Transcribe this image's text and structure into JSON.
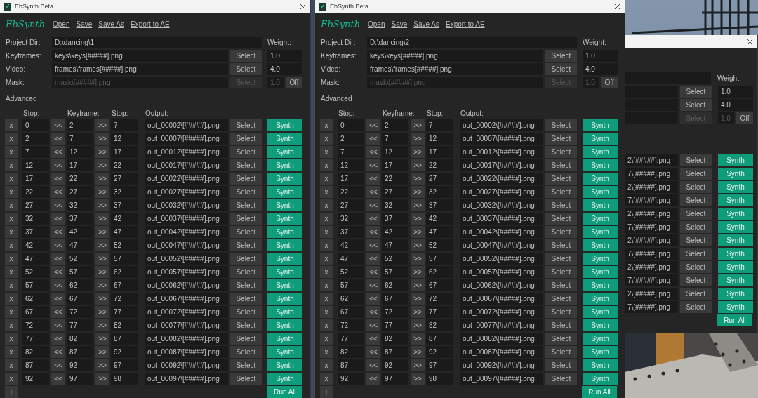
{
  "windows": [
    {
      "title": "EbSynth Beta",
      "logo": "EbSynth",
      "menu": [
        "Open",
        "Save",
        "Save As",
        "Export to AE"
      ],
      "project_dir": {
        "label": "Project Dir:",
        "value": "D:\\dancing\\1"
      },
      "weight_label": "Weight:",
      "inputs": [
        {
          "label": "Keyframes:",
          "value": "keys\\keys[#####].png",
          "select": "Select",
          "weight": "1.0",
          "disabled": false
        },
        {
          "label": "Video:",
          "value": "frames\\frames[#####].png",
          "select": "Select",
          "weight": "4.0",
          "disabled": false
        },
        {
          "label": "Mask:",
          "value": "mask\\[#####].png",
          "select": "Select",
          "weight": "1.0",
          "disabled": true,
          "toggle": "Off"
        }
      ],
      "advanced": "Advanced",
      "headers": [
        "Stop:",
        "Keyframe:",
        "Stop:",
        "Output:"
      ],
      "rows": [
        {
          "x": "x",
          "from": "0",
          "back": "<<",
          "key": "2",
          "fwd": ">>",
          "to": "7",
          "output": "out_00002\\[#####].png",
          "select": "Select",
          "synth": "Synth"
        },
        {
          "x": "x",
          "from": "2",
          "back": "<<",
          "key": "7",
          "fwd": ">>",
          "to": "12",
          "output": "out_00007\\[#####].png",
          "select": "Select",
          "synth": "Synth"
        },
        {
          "x": "x",
          "from": "7",
          "back": "<<",
          "key": "12",
          "fwd": ">>",
          "to": "17",
          "output": "out_00012\\[#####].png",
          "select": "Select",
          "synth": "Synth"
        },
        {
          "x": "x",
          "from": "12",
          "back": "<<",
          "key": "17",
          "fwd": ">>",
          "to": "22",
          "output": "out_00017\\[#####].png",
          "select": "Select",
          "synth": "Synth"
        },
        {
          "x": "x",
          "from": "17",
          "back": "<<",
          "key": "22",
          "fwd": ">>",
          "to": "27",
          "output": "out_00022\\[#####].png",
          "select": "Select",
          "synth": "Synth"
        },
        {
          "x": "x",
          "from": "22",
          "back": "<<",
          "key": "27",
          "fwd": ">>",
          "to": "32",
          "output": "out_00027\\[#####].png",
          "select": "Select",
          "synth": "Synth"
        },
        {
          "x": "x",
          "from": "27",
          "back": "<<",
          "key": "32",
          "fwd": ">>",
          "to": "37",
          "output": "out_00032\\[#####].png",
          "select": "Select",
          "synth": "Synth"
        },
        {
          "x": "x",
          "from": "32",
          "back": "<<",
          "key": "37",
          "fwd": ">>",
          "to": "42",
          "output": "out_00037\\[#####].png",
          "select": "Select",
          "synth": "Synth"
        },
        {
          "x": "x",
          "from": "37",
          "back": "<<",
          "key": "42",
          "fwd": ">>",
          "to": "47",
          "output": "out_00042\\[#####].png",
          "select": "Select",
          "synth": "Synth"
        },
        {
          "x": "x",
          "from": "42",
          "back": "<<",
          "key": "47",
          "fwd": ">>",
          "to": "52",
          "output": "out_00047\\[#####].png",
          "select": "Select",
          "synth": "Synth"
        },
        {
          "x": "x",
          "from": "47",
          "back": "<<",
          "key": "52",
          "fwd": ">>",
          "to": "57",
          "output": "out_00052\\[#####].png",
          "select": "Select",
          "synth": "Synth"
        },
        {
          "x": "x",
          "from": "52",
          "back": "<<",
          "key": "57",
          "fwd": ">>",
          "to": "62",
          "output": "out_00057\\[#####].png",
          "select": "Select",
          "synth": "Synth"
        },
        {
          "x": "x",
          "from": "57",
          "back": "<<",
          "key": "62",
          "fwd": ">>",
          "to": "67",
          "output": "out_00062\\[#####].png",
          "select": "Select",
          "synth": "Synth"
        },
        {
          "x": "x",
          "from": "62",
          "back": "<<",
          "key": "67",
          "fwd": ">>",
          "to": "72",
          "output": "out_00067\\[#####].png",
          "select": "Select",
          "synth": "Synth"
        },
        {
          "x": "x",
          "from": "67",
          "back": "<<",
          "key": "72",
          "fwd": ">>",
          "to": "77",
          "output": "out_00072\\[#####].png",
          "select": "Select",
          "synth": "Synth"
        },
        {
          "x": "x",
          "from": "72",
          "back": "<<",
          "key": "77",
          "fwd": ">>",
          "to": "82",
          "output": "out_00077\\[#####].png",
          "select": "Select",
          "synth": "Synth"
        },
        {
          "x": "x",
          "from": "77",
          "back": "<<",
          "key": "82",
          "fwd": ">>",
          "to": "87",
          "output": "out_00082\\[#####].png",
          "select": "Select",
          "synth": "Synth"
        },
        {
          "x": "x",
          "from": "82",
          "back": "<<",
          "key": "87",
          "fwd": ">>",
          "to": "92",
          "output": "out_00087\\[#####].png",
          "select": "Select",
          "synth": "Synth"
        },
        {
          "x": "x",
          "from": "87",
          "back": "<<",
          "key": "92",
          "fwd": ">>",
          "to": "97",
          "output": "out_00092\\[#####].png",
          "select": "Select",
          "synth": "Synth"
        },
        {
          "x": "x",
          "from": "92",
          "back": "<<",
          "key": "97",
          "fwd": ">>",
          "to": "98",
          "output": "out_00097\\[#####].png",
          "select": "Select",
          "synth": "Synth"
        }
      ],
      "add": "+",
      "run_all": "Run All"
    },
    {
      "title": "EbSynth Beta",
      "logo": "EbSynth",
      "menu": [
        "Open",
        "Save",
        "Save As",
        "Export to AE"
      ],
      "project_dir": {
        "label": "Project Dir:",
        "value": "D:\\dancing\\2"
      },
      "weight_label": "Weight:",
      "inputs": [
        {
          "label": "Keyframes:",
          "value": "keys\\keys[#####].png",
          "select": "Select",
          "weight": "1.0",
          "disabled": false
        },
        {
          "label": "Video:",
          "value": "frames\\frames[#####].png",
          "select": "Select",
          "weight": "4.0",
          "disabled": false
        },
        {
          "label": "Mask:",
          "value": "mask\\[#####].png",
          "select": "Select",
          "weight": "1.0",
          "disabled": true,
          "toggle": "Off"
        }
      ],
      "advanced": "Advanced",
      "headers": [
        "Stop:",
        "Keyframe:",
        "Stop:",
        "Output:"
      ],
      "rows": [
        {
          "x": "x",
          "from": "0",
          "back": "<<",
          "key": "2",
          "fwd": ">>",
          "to": "7",
          "output": "out_00002\\[#####].png",
          "select": "Select",
          "synth": "Synth"
        },
        {
          "x": "x",
          "from": "2",
          "back": "<<",
          "key": "7",
          "fwd": ">>",
          "to": "12",
          "output": "out_00007\\[#####].png",
          "select": "Select",
          "synth": "Synth"
        },
        {
          "x": "x",
          "from": "7",
          "back": "<<",
          "key": "12",
          "fwd": ">>",
          "to": "17",
          "output": "out_00012\\[#####].png",
          "select": "Select",
          "synth": "Synth"
        },
        {
          "x": "x",
          "from": "12",
          "back": "<<",
          "key": "17",
          "fwd": ">>",
          "to": "22",
          "output": "out_00017\\[#####].png",
          "select": "Select",
          "synth": "Synth"
        },
        {
          "x": "x",
          "from": "17",
          "back": "<<",
          "key": "22",
          "fwd": ">>",
          "to": "27",
          "output": "out_00022\\[#####].png",
          "select": "Select",
          "synth": "Synth"
        },
        {
          "x": "x",
          "from": "22",
          "back": "<<",
          "key": "27",
          "fwd": ">>",
          "to": "32",
          "output": "out_00027\\[#####].png",
          "select": "Select",
          "synth": "Synth"
        },
        {
          "x": "x",
          "from": "27",
          "back": "<<",
          "key": "32",
          "fwd": ">>",
          "to": "37",
          "output": "out_00032\\[#####].png",
          "select": "Select",
          "synth": "Synth"
        },
        {
          "x": "x",
          "from": "32",
          "back": "<<",
          "key": "37",
          "fwd": ">>",
          "to": "42",
          "output": "out_00037\\[#####].png",
          "select": "Select",
          "synth": "Synth"
        },
        {
          "x": "x",
          "from": "37",
          "back": "<<",
          "key": "42",
          "fwd": ">>",
          "to": "47",
          "output": "out_00042\\[#####].png",
          "select": "Select",
          "synth": "Synth"
        },
        {
          "x": "x",
          "from": "42",
          "back": "<<",
          "key": "47",
          "fwd": ">>",
          "to": "52",
          "output": "out_00047\\[#####].png",
          "select": "Select",
          "synth": "Synth"
        },
        {
          "x": "x",
          "from": "47",
          "back": "<<",
          "key": "52",
          "fwd": ">>",
          "to": "57",
          "output": "out_00052\\[#####].png",
          "select": "Select",
          "synth": "Synth"
        },
        {
          "x": "x",
          "from": "52",
          "back": "<<",
          "key": "57",
          "fwd": ">>",
          "to": "62",
          "output": "out_00057\\[#####].png",
          "select": "Select",
          "synth": "Synth"
        },
        {
          "x": "x",
          "from": "57",
          "back": "<<",
          "key": "62",
          "fwd": ">>",
          "to": "67",
          "output": "out_00062\\[#####].png",
          "select": "Select",
          "synth": "Synth"
        },
        {
          "x": "x",
          "from": "62",
          "back": "<<",
          "key": "67",
          "fwd": ">>",
          "to": "72",
          "output": "out_00067\\[#####].png",
          "select": "Select",
          "synth": "Synth"
        },
        {
          "x": "x",
          "from": "67",
          "back": "<<",
          "key": "72",
          "fwd": ">>",
          "to": "77",
          "output": "out_00072\\[#####].png",
          "select": "Select",
          "synth": "Synth"
        },
        {
          "x": "x",
          "from": "72",
          "back": "<<",
          "key": "77",
          "fwd": ">>",
          "to": "82",
          "output": "out_00077\\[#####].png",
          "select": "Select",
          "synth": "Synth"
        },
        {
          "x": "x",
          "from": "77",
          "back": "<<",
          "key": "82",
          "fwd": ">>",
          "to": "87",
          "output": "out_00082\\[#####].png",
          "select": "Select",
          "synth": "Synth"
        },
        {
          "x": "x",
          "from": "82",
          "back": "<<",
          "key": "87",
          "fwd": ">>",
          "to": "92",
          "output": "out_00087\\[#####].png",
          "select": "Select",
          "synth": "Synth"
        },
        {
          "x": "x",
          "from": "87",
          "back": "<<",
          "key": "92",
          "fwd": ">>",
          "to": "97",
          "output": "out_00092\\[#####].png",
          "select": "Select",
          "synth": "Synth"
        },
        {
          "x": "x",
          "from": "92",
          "back": "<<",
          "key": "97",
          "fwd": ">>",
          "to": "98",
          "output": "out_00097\\[#####].png",
          "select": "Select",
          "synth": "Synth"
        }
      ],
      "add": "+",
      "run_all": "Run All"
    }
  ],
  "background_window": {
    "weight_label": "Weight:",
    "inputs": [
      {
        "select": "Select",
        "weight": "1.0",
        "disabled": false
      },
      {
        "select": "Select",
        "weight": "4.0",
        "disabled": false
      },
      {
        "select": "Select",
        "weight": "1.0",
        "disabled": true,
        "toggle": "Off"
      }
    ],
    "rows": [
      {
        "output": "2\\[#####].png",
        "select": "Select",
        "synth": "Synth"
      },
      {
        "output": "7\\[#####].png",
        "select": "Select",
        "synth": "Synth"
      },
      {
        "output": "2\\[#####].png",
        "select": "Select",
        "synth": "Synth"
      },
      {
        "output": "7\\[#####].png",
        "select": "Select",
        "synth": "Synth"
      },
      {
        "output": "2\\[#####].png",
        "select": "Select",
        "synth": "Synth"
      },
      {
        "output": "7\\[#####].png",
        "select": "Select",
        "synth": "Synth"
      },
      {
        "output": "2\\[#####].png",
        "select": "Select",
        "synth": "Synth"
      },
      {
        "output": "7\\[#####].png",
        "select": "Select",
        "synth": "Synth"
      },
      {
        "output": "2\\[#####].png",
        "select": "Select",
        "synth": "Synth"
      },
      {
        "output": "7\\[#####].png",
        "select": "Select",
        "synth": "Synth"
      },
      {
        "output": "2\\[#####].png",
        "select": "Select",
        "synth": "Synth"
      },
      {
        "output": "7\\[#####].png",
        "select": "Select",
        "synth": "Synth"
      }
    ],
    "run_all": "Run All"
  }
}
